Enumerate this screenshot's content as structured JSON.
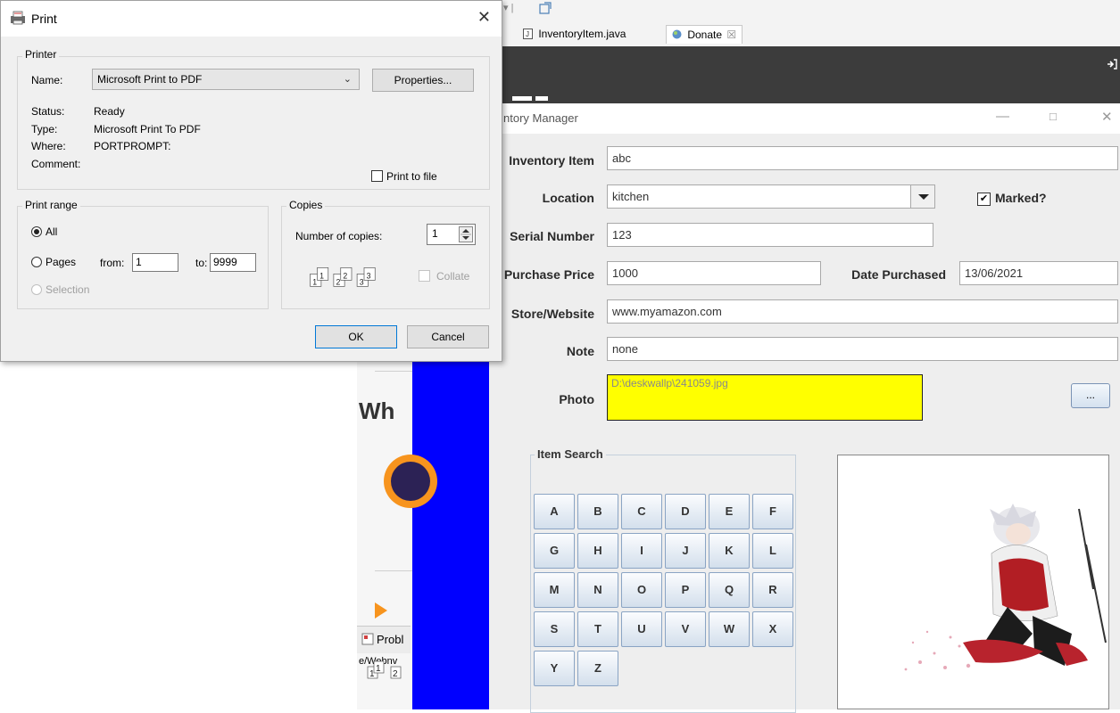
{
  "ide": {
    "tabs": [
      {
        "label": "InventoryItem.java",
        "icon": "java-file-icon"
      },
      {
        "label": "Donate",
        "icon": "globe-icon",
        "close": "☒"
      }
    ],
    "heading_fragment": "Wh",
    "problems_label": "Probl",
    "login_icon": "login-icon",
    "ghost_text": "e/Webnv"
  },
  "inventory": {
    "title": "ntory Manager",
    "fields": {
      "inventory_item": {
        "label": "Inventory Item",
        "value": "abc"
      },
      "location": {
        "label": "Location",
        "value": "kitchen"
      },
      "marked": {
        "label": "Marked?",
        "checked": true
      },
      "serial": {
        "label": "Serial Number",
        "value": "123"
      },
      "price": {
        "label": "Purchase Price",
        "value": "1000"
      },
      "date": {
        "label": "Date Purchased",
        "value": "13/06/2021"
      },
      "store": {
        "label": "Store/Website",
        "value": "www.myamazon.com"
      },
      "note": {
        "label": "Note",
        "value": "none"
      },
      "photo": {
        "label": "Photo",
        "value": "D:\\deskwallp\\241059.jpg",
        "browse_label": "..."
      }
    },
    "search": {
      "title": "Item Search",
      "keys": [
        "A",
        "B",
        "C",
        "D",
        "E",
        "F",
        "G",
        "H",
        "I",
        "J",
        "K",
        "L",
        "M",
        "N",
        "O",
        "P",
        "Q",
        "R",
        "S",
        "T",
        "U",
        "V",
        "W",
        "X",
        "Y",
        "Z"
      ]
    },
    "colors": {
      "photo_bg": "#ffff00",
      "side_bar": "#0000ff"
    }
  },
  "print": {
    "title": "Print",
    "close": "✕",
    "printer": {
      "group_title": "Printer",
      "name_label": "Name:",
      "name_value": "Microsoft Print to PDF",
      "properties_label": "Properties...",
      "status_label": "Status:",
      "status_value": "Ready",
      "type_label": "Type:",
      "type_value": "Microsoft Print To PDF",
      "where_label": "Where:",
      "where_value": "PORTPROMPT:",
      "comment_label": "Comment:",
      "print_to_file_label": "Print to file"
    },
    "range": {
      "group_title": "Print range",
      "all_label": "All",
      "pages_label": "Pages",
      "from_label": "from:",
      "from_value": "1",
      "to_label": "to:",
      "to_value": "9999",
      "selection_label": "Selection",
      "selected": "All"
    },
    "copies": {
      "group_title": "Copies",
      "number_label": "Number of copies:",
      "number_value": "1",
      "collate_label": "Collate"
    },
    "ok_label": "OK",
    "cancel_label": "Cancel"
  }
}
